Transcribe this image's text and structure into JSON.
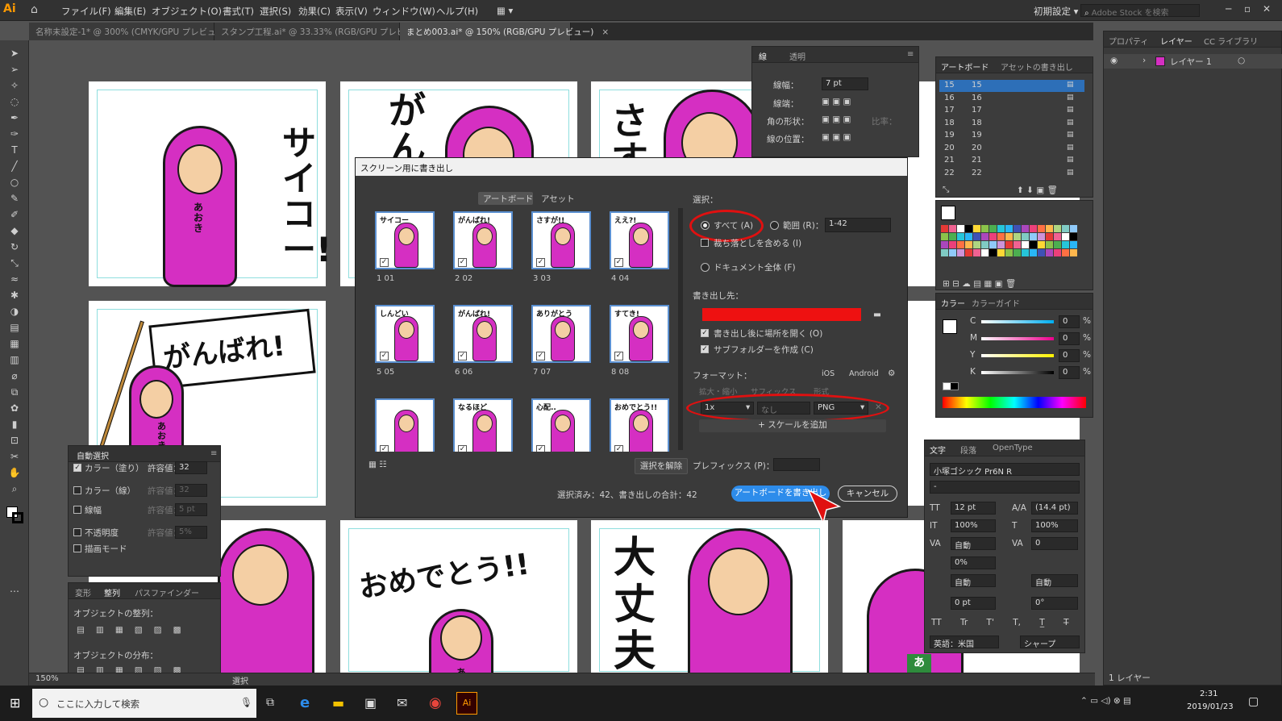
{
  "app": {
    "logo": "Ai",
    "workspace": "初期設定",
    "stock_search_placeholder": "Adobe Stock を検索"
  },
  "menu": [
    "ファイル(F)",
    "編集(E)",
    "オブジェクト(O)",
    "書式(T)",
    "選択(S)",
    "効果(C)",
    "表示(V)",
    "ウィンドウ(W)",
    "ヘルプ(H)"
  ],
  "doc_tabs": [
    {
      "label": "名称未設定-1* @ 300% (CMYK/GPU プレビュー)"
    },
    {
      "label": "スタンプ工程.ai* @ 33.33% (RGB/GPU プレビュー)"
    },
    {
      "label": "まとめ003.ai* @ 150% (RGB/GPU プレビュー)"
    }
  ],
  "artwork": {
    "a1_text": "サイコー!",
    "a1_name": "あおき",
    "a2_text": "がん",
    "a3_text": "さす",
    "b1_text": "がんばれ!",
    "b1_name": "あおき",
    "c2_text": "おめでとう!!",
    "c2_name": "あ",
    "c3_text": "大丈夫",
    "c4_name": "あ"
  },
  "stroke_panel": {
    "tabs": [
      "線",
      "透明"
    ],
    "weight_label": "線幅：",
    "weight_value": "7 pt",
    "cap_label": "線端：",
    "corner_label": "角の形状：",
    "limit_label": "比率：",
    "align_label": "線の位置："
  },
  "artboards_panel": {
    "tabs": [
      "アートボード",
      "アセットの書き出し"
    ],
    "rows": [
      {
        "num": "15",
        "name": "15"
      },
      {
        "num": "16",
        "name": "16"
      },
      {
        "num": "17",
        "name": "17"
      },
      {
        "num": "18",
        "name": "18"
      },
      {
        "num": "19",
        "name": "19"
      },
      {
        "num": "20",
        "name": "20"
      },
      {
        "num": "21",
        "name": "21"
      },
      {
        "num": "22",
        "name": "22"
      }
    ]
  },
  "layers_panel": {
    "tabs": [
      "プロパティ",
      "レイヤー",
      "CC ライブラリ"
    ],
    "layer_name": "レイヤー 1",
    "footer": "1 レイヤー"
  },
  "color_panel": {
    "tabs": [
      "カラー",
      "カラーガイド"
    ],
    "channels": [
      {
        "name": "C",
        "value": "0",
        "unit": "%"
      },
      {
        "name": "M",
        "value": "0",
        "unit": "%"
      },
      {
        "name": "Y",
        "value": "0",
        "unit": "%"
      },
      {
        "name": "K",
        "value": "0",
        "unit": "%"
      }
    ]
  },
  "char_panel": {
    "tabs": [
      "文字",
      "段落",
      "OpenType"
    ],
    "font": "小塚ゴシック Pr6N R",
    "style": "-",
    "size": "12 pt",
    "leading": "(14.4 pt)",
    "vscale": "100%",
    "hscale": "100%",
    "kerning": "自動",
    "tracking": "0",
    "tsume": "0%",
    "aki1": "自動",
    "aki2": "自動",
    "baseline": "0 pt",
    "rotation": "0°",
    "tt_buttons": [
      "TT",
      "Tr",
      "T'",
      "T,",
      "T̲",
      "T̶"
    ],
    "language": "英語：米国",
    "antialias": "シャープ"
  },
  "magic_wand": {
    "title": "自動選択",
    "rows": [
      {
        "label": "カラー（塗り）",
        "tol_label": "許容値：",
        "value": "32",
        "checked": true
      },
      {
        "label": "カラー（線）",
        "tol_label": "許容値：",
        "value": "32",
        "checked": false
      },
      {
        "label": "線幅",
        "tol_label": "許容値：",
        "value": "5 pt",
        "checked": false
      },
      {
        "label": "不透明度",
        "tol_label": "許容値：",
        "value": "5%",
        "checked": false
      },
      {
        "label": "描画モード",
        "checked": false
      }
    ]
  },
  "align_panel": {
    "tabs": [
      "変形",
      "整列",
      "パスファインダー"
    ],
    "align_label": "オブジェクトの整列：",
    "distribute_label": "オブジェクトの分布："
  },
  "export_dialog": {
    "title": "スクリーン用に書き出し",
    "tabs": [
      "アートボード",
      "アセット"
    ],
    "thumbs": [
      {
        "label": "1   01",
        "text": "サイコー"
      },
      {
        "label": "2   02",
        "text": "がんばれ!"
      },
      {
        "label": "3   03",
        "text": "さすが!!"
      },
      {
        "label": "4   04",
        "text": "ええ?!"
      },
      {
        "label": "5   05",
        "text": "しんどい"
      },
      {
        "label": "6   06",
        "text": "がんばれ!"
      },
      {
        "label": "7   07",
        "text": "ありがとう"
      },
      {
        "label": "8   08",
        "text": "すてき!"
      },
      {
        "label": "",
        "text": ""
      },
      {
        "label": "",
        "text": "なるほど"
      },
      {
        "label": "",
        "text": "心配.."
      },
      {
        "label": "",
        "text": "おめでとう!!"
      }
    ],
    "select_heading": "選択：",
    "all_label": "すべて (A)",
    "range_label": "範囲 (R)：",
    "range_value": "1-42",
    "bleed_label": "裁ち落としを含める (I)",
    "whole_doc_label": "ドキュメント全体 (F)",
    "export_to_heading": "書き出し先：",
    "open_after_label": "書き出し後に場所を開く (O)",
    "subfolder_label": "サブフォルダーを作成 (C)",
    "format_heading": "フォーマット：",
    "presets": [
      "iOS",
      "Android"
    ],
    "col_scale": "拡大・縮小",
    "col_suffix": "サフィックス",
    "col_format": "形式",
    "scale_value": "1x",
    "suffix_placeholder": "なし",
    "format_value": "PNG",
    "add_scale_label": "+ スケールを追加",
    "deselect_label": "選択を解除",
    "prefix_label": "プレフィックス (P)：",
    "status": "選択済み：42、書き出しの合計：42",
    "export_button": "アートボードを書き出し",
    "cancel_button": "キャンセル"
  },
  "status_bar": {
    "zoom": "150%",
    "mode": "選択"
  },
  "taskbar": {
    "search_placeholder": "ここに入力して検索",
    "time": "2:31",
    "date": "2019/01/23"
  },
  "colors": {
    "accent": "#2d8ceb",
    "figure": "#d52fc2",
    "highlight_red": "#e01010"
  }
}
